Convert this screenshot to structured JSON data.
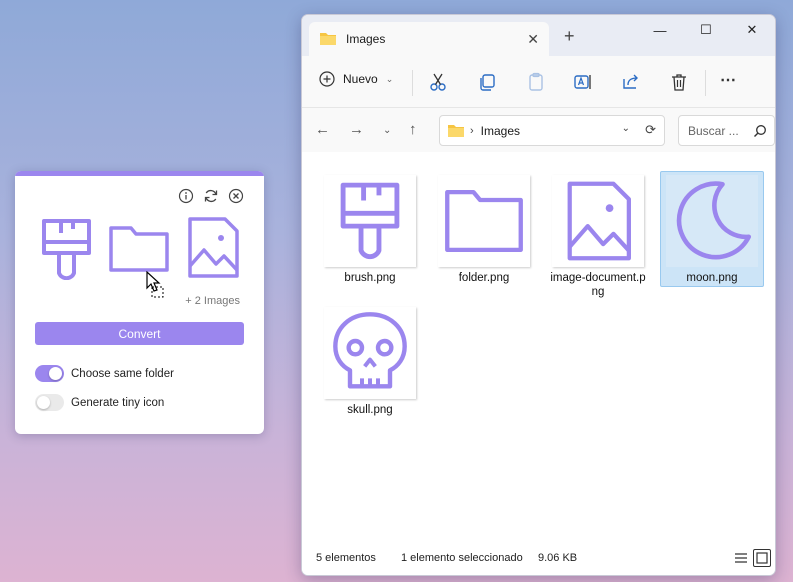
{
  "widget": {
    "more_images": "+ 2 Images",
    "convert_label": "Convert",
    "toggle_same_folder": {
      "label": "Choose same folder",
      "on": true
    },
    "toggle_tiny_icon": {
      "label": "Generate tiny icon",
      "on": false
    },
    "accent": "#9b86ee",
    "icons": [
      "info-icon",
      "refresh-icon",
      "close-icon"
    ],
    "thumbnails": [
      "brush-icon",
      "folder-icon",
      "image-icon"
    ]
  },
  "explorer": {
    "tab_title": "Images",
    "toolbar": {
      "new_label": "Nuevo",
      "actions": [
        "cut-icon",
        "copy-icon",
        "paste-icon",
        "rename-icon",
        "share-icon",
        "delete-icon",
        "more-icon"
      ]
    },
    "address": {
      "path": "Images"
    },
    "search": {
      "placeholder": "Buscar ..."
    },
    "files": [
      {
        "name": "brush.png",
        "icon": "brush-icon",
        "selected": false
      },
      {
        "name": "folder.png",
        "icon": "folder-icon",
        "selected": false
      },
      {
        "name": "image-document.png",
        "icon": "image-icon",
        "selected": false
      },
      {
        "name": "moon.png",
        "icon": "moon-icon",
        "selected": true
      },
      {
        "name": "skull.png",
        "icon": "skull-icon",
        "selected": false
      }
    ],
    "status": {
      "count": "5 elementos",
      "selection": "1 elemento seleccionado",
      "size": "9.06 KB"
    }
  }
}
